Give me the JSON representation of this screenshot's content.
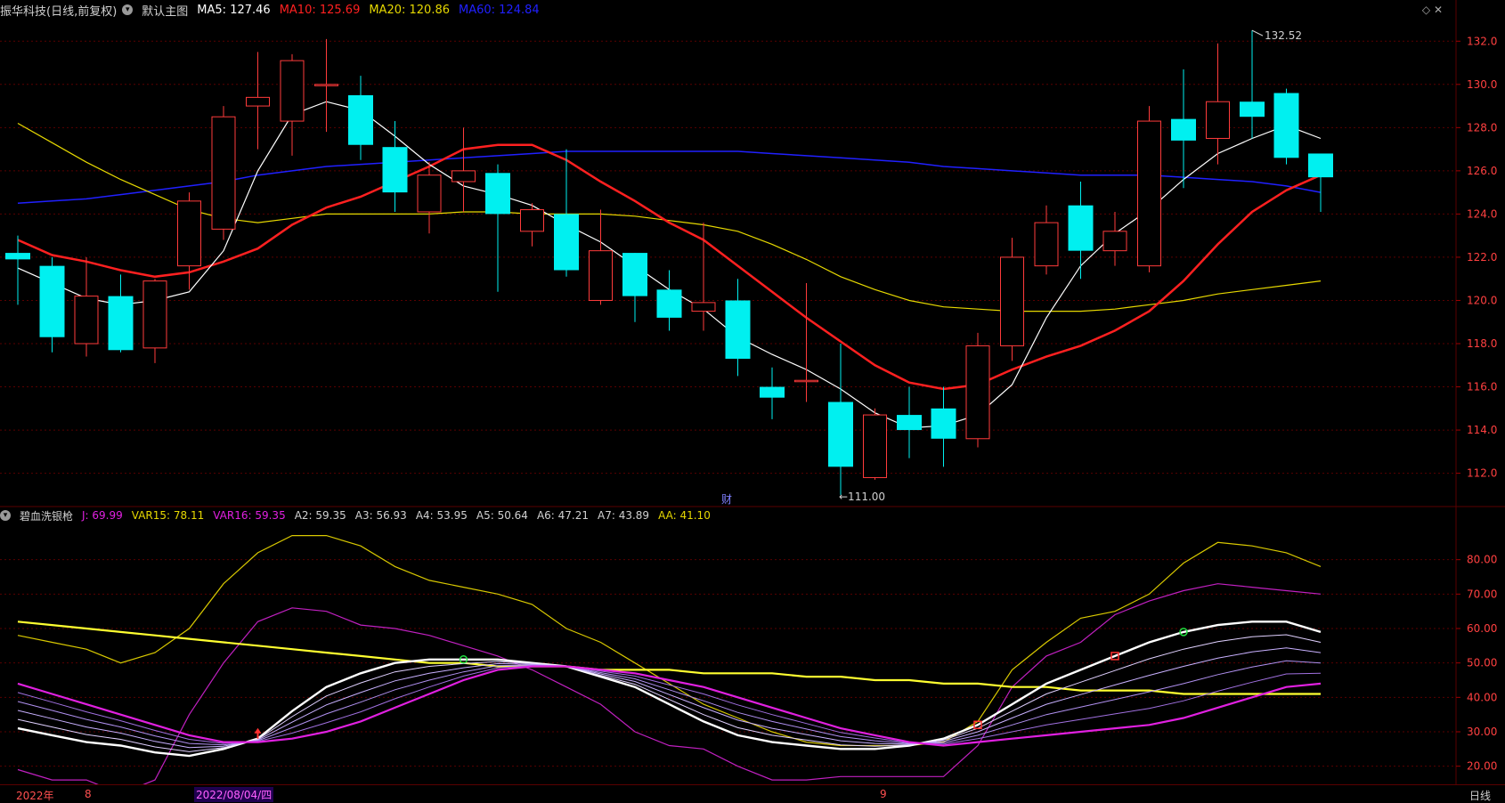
{
  "header": {
    "stock_name": "振华科技(日线,前复权)",
    "main_chart_label": "默认主图",
    "ma": [
      {
        "label": "MA5: 127.46",
        "color": "#ffffff"
      },
      {
        "label": "MA10: 125.69",
        "color": "#ff2020"
      },
      {
        "label": "MA20: 120.86",
        "color": "#e6d800"
      },
      {
        "label": "MA60: 124.84",
        "color": "#2020ff"
      }
    ]
  },
  "indicator": {
    "name": "碧血洗银枪",
    "values": [
      {
        "label": "J: 69.99",
        "color": "#e020e0"
      },
      {
        "label": "VAR15: 78.11",
        "color": "#e6d800"
      },
      {
        "label": "VAR16: 59.35",
        "color": "#e020e0"
      },
      {
        "label": "A2: 59.35",
        "color": "#d0d0d0"
      },
      {
        "label": "A3: 56.93",
        "color": "#d0d0d0"
      },
      {
        "label": "A4: 53.95",
        "color": "#d0d0d0"
      },
      {
        "label": "A5: 50.64",
        "color": "#d0d0d0"
      },
      {
        "label": "A6: 47.21",
        "color": "#d0d0d0"
      },
      {
        "label": "A7: 43.89",
        "color": "#d0d0d0"
      },
      {
        "label": "AA: 41.10",
        "color": "#e6d800"
      }
    ]
  },
  "price_axis_labels": [
    "132.0",
    "130.0",
    "128.0",
    "126.0",
    "124.0",
    "122.0",
    "120.0",
    "118.0",
    "116.0",
    "114.0",
    "112.0"
  ],
  "ind_axis_labels": [
    "80.00",
    "70.00",
    "60.00",
    "50.00",
    "40.00",
    "30.00",
    "20.00"
  ],
  "annotations": {
    "high": "132.52",
    "low": "111.00",
    "finance_marker": "财"
  },
  "bottom": {
    "year_label": "2022年",
    "month_aug": "8",
    "date_cursor": "2022/08/04/四",
    "month_sep": "9",
    "period": "日线"
  },
  "colors": {
    "up": "#ff3b3b",
    "down": "#00f0f0",
    "grid": "#5a0000",
    "ma5": "#ffffff",
    "ma10": "#ff2020",
    "ma20": "#e6d800",
    "ma60": "#2020ff"
  },
  "chart_data": {
    "type": "candlestick",
    "candles": [
      {
        "o": 122.2,
        "c": 121.9,
        "h": 123.0,
        "l": 119.8
      },
      {
        "o": 121.6,
        "c": 118.3,
        "h": 122.0,
        "l": 117.6
      },
      {
        "o": 118.0,
        "c": 120.2,
        "h": 122.0,
        "l": 117.4
      },
      {
        "o": 120.2,
        "c": 117.7,
        "h": 121.2,
        "l": 117.6
      },
      {
        "o": 117.8,
        "c": 120.9,
        "h": 121.0,
        "l": 117.1
      },
      {
        "o": 121.6,
        "c": 124.6,
        "h": 125.0,
        "l": 120.5
      },
      {
        "o": 123.3,
        "c": 128.5,
        "h": 129.0,
        "l": 122.8
      },
      {
        "o": 129.0,
        "c": 129.4,
        "h": 131.5,
        "l": 127.0
      },
      {
        "o": 128.3,
        "c": 131.1,
        "h": 131.4,
        "l": 126.7
      },
      {
        "o": 130.0,
        "c": 130.0,
        "h": 132.1,
        "l": 127.8
      },
      {
        "o": 129.5,
        "c": 127.2,
        "h": 130.4,
        "l": 126.5
      },
      {
        "o": 127.1,
        "c": 125.0,
        "h": 128.3,
        "l": 124.1
      },
      {
        "o": 124.1,
        "c": 125.8,
        "h": 126.4,
        "l": 123.1
      },
      {
        "o": 125.5,
        "c": 126.0,
        "h": 128.0,
        "l": 124.1
      },
      {
        "o": 125.9,
        "c": 124.0,
        "h": 126.3,
        "l": 120.4
      },
      {
        "o": 123.2,
        "c": 124.2,
        "h": 124.5,
        "l": 122.5
      },
      {
        "o": 124.0,
        "c": 121.4,
        "h": 127.0,
        "l": 121.1
      },
      {
        "o": 120.0,
        "c": 122.3,
        "h": 124.2,
        "l": 119.8
      },
      {
        "o": 122.2,
        "c": 120.2,
        "h": 122.2,
        "l": 119.0
      },
      {
        "o": 120.5,
        "c": 119.2,
        "h": 121.4,
        "l": 118.6
      },
      {
        "o": 119.5,
        "c": 119.9,
        "h": 123.6,
        "l": 118.6
      },
      {
        "o": 120.0,
        "c": 117.3,
        "h": 121.0,
        "l": 116.5
      },
      {
        "o": 116.0,
        "c": 115.5,
        "h": 116.9,
        "l": 114.5
      },
      {
        "o": 116.3,
        "c": 116.3,
        "h": 120.8,
        "l": 115.3
      },
      {
        "o": 115.3,
        "c": 112.3,
        "h": 118.0,
        "l": 111.0
      },
      {
        "o": 111.8,
        "c": 114.7,
        "h": 115.0,
        "l": 111.7
      },
      {
        "o": 114.7,
        "c": 114.0,
        "h": 116.0,
        "l": 112.7
      },
      {
        "o": 115.0,
        "c": 113.6,
        "h": 116.0,
        "l": 112.3
      },
      {
        "o": 113.6,
        "c": 117.9,
        "h": 118.5,
        "l": 113.2
      },
      {
        "o": 117.9,
        "c": 122.0,
        "h": 122.9,
        "l": 117.2
      },
      {
        "o": 121.6,
        "c": 123.6,
        "h": 124.4,
        "l": 121.2
      },
      {
        "o": 124.4,
        "c": 122.3,
        "h": 125.5,
        "l": 121.0
      },
      {
        "o": 122.3,
        "c": 123.2,
        "h": 124.1,
        "l": 121.6
      },
      {
        "o": 121.6,
        "c": 128.3,
        "h": 129.0,
        "l": 121.3
      },
      {
        "o": 128.4,
        "c": 127.4,
        "h": 130.7,
        "l": 125.2
      },
      {
        "o": 127.5,
        "c": 129.2,
        "h": 131.9,
        "l": 126.3
      },
      {
        "o": 129.2,
        "c": 128.5,
        "h": 132.5,
        "l": 127.5
      },
      {
        "o": 129.6,
        "c": 126.6,
        "h": 129.8,
        "l": 126.3
      },
      {
        "o": 126.8,
        "c": 125.7,
        "h": 126.8,
        "l": 124.1
      }
    ],
    "ma5": [
      121.5,
      120.8,
      120.1,
      119.8,
      120.0,
      120.4,
      122.3,
      126.0,
      128.6,
      129.2,
      128.8,
      127.6,
      126.3,
      125.3,
      124.9,
      124.4,
      123.5,
      122.7,
      121.6,
      120.5,
      119.6,
      118.3,
      117.5,
      116.8,
      115.9,
      114.8,
      114.1,
      114.2,
      114.7,
      116.1,
      119.2,
      121.6,
      123.1,
      124.2,
      125.6,
      126.8,
      127.5,
      128.1,
      127.5
    ],
    "ma10": [
      122.8,
      122.1,
      121.8,
      121.4,
      121.1,
      121.3,
      121.8,
      122.4,
      123.5,
      124.3,
      124.8,
      125.5,
      126.2,
      127.0,
      127.2,
      127.2,
      126.5,
      125.5,
      124.6,
      123.6,
      122.8,
      121.6,
      120.4,
      119.2,
      118.1,
      117.0,
      116.2,
      115.9,
      116.1,
      116.8,
      117.4,
      117.9,
      118.6,
      119.5,
      120.9,
      122.6,
      124.1,
      125.1,
      125.8
    ],
    "ma20": [
      128.2,
      127.3,
      126.4,
      125.6,
      124.9,
      124.2,
      123.8,
      123.6,
      123.8,
      124.0,
      124.0,
      124.0,
      124.0,
      124.1,
      124.1,
      124.0,
      124.0,
      124.0,
      123.9,
      123.7,
      123.5,
      123.2,
      122.6,
      121.9,
      121.1,
      120.5,
      120.0,
      119.7,
      119.6,
      119.5,
      119.5,
      119.5,
      119.6,
      119.8,
      120.0,
      120.3,
      120.5,
      120.7,
      120.9
    ],
    "ma60": [
      124.5,
      124.6,
      124.7,
      124.9,
      125.1,
      125.3,
      125.5,
      125.8,
      126.0,
      126.2,
      126.3,
      126.4,
      126.5,
      126.6,
      126.7,
      126.8,
      126.9,
      126.9,
      126.9,
      126.9,
      126.9,
      126.9,
      126.8,
      126.7,
      126.6,
      126.5,
      126.4,
      126.2,
      126.1,
      126.0,
      125.9,
      125.8,
      125.8,
      125.8,
      125.7,
      125.6,
      125.5,
      125.3,
      125.0
    ],
    "ind": {
      "var15": [
        58,
        56,
        54,
        50,
        53,
        60,
        73,
        82,
        87,
        87,
        84,
        78,
        74,
        72,
        70,
        67,
        60,
        56,
        50,
        44,
        38,
        34,
        30,
        27,
        26,
        26,
        26,
        27,
        33,
        48,
        56,
        63,
        65,
        70,
        79,
        85,
        84,
        82,
        78
      ],
      "j": [
        19,
        16,
        16,
        12,
        16,
        35,
        50,
        62,
        66,
        65,
        61,
        60,
        58,
        55,
        52,
        48,
        43,
        38,
        30,
        26,
        25,
        20,
        16,
        16,
        17,
        17,
        17,
        17,
        26,
        43,
        52,
        56,
        64,
        68,
        71,
        73,
        72,
        71,
        70
      ],
      "a2": [
        31,
        29,
        27,
        26,
        24,
        23,
        25,
        28,
        36,
        43,
        47,
        50,
        51,
        51,
        51,
        50,
        49,
        46,
        43,
        38,
        33,
        29,
        27,
        26,
        25,
        25,
        26,
        28,
        32,
        38,
        44,
        48,
        52,
        56,
        59,
        61,
        62,
        62,
        59
      ],
      "var16": [
        44,
        41,
        38,
        35,
        32,
        29,
        27,
        27,
        28,
        30,
        33,
        37,
        41,
        45,
        48,
        49,
        49,
        48,
        47,
        45,
        43,
        40,
        37,
        34,
        31,
        29,
        27,
        26,
        27,
        28,
        29,
        30,
        31,
        32,
        34,
        37,
        40,
        43,
        44
      ],
      "aa": [
        62,
        61,
        60,
        59,
        58,
        57,
        56,
        55,
        54,
        53,
        52,
        51,
        50,
        50,
        49,
        49,
        49,
        48,
        48,
        48,
        47,
        47,
        47,
        46,
        46,
        45,
        45,
        44,
        44,
        43,
        43,
        42,
        42,
        42,
        41,
        41,
        41,
        41,
        41
      ]
    },
    "ylim_price": [
      110.5,
      133
    ],
    "ylim_ind": [
      15,
      90
    ]
  }
}
